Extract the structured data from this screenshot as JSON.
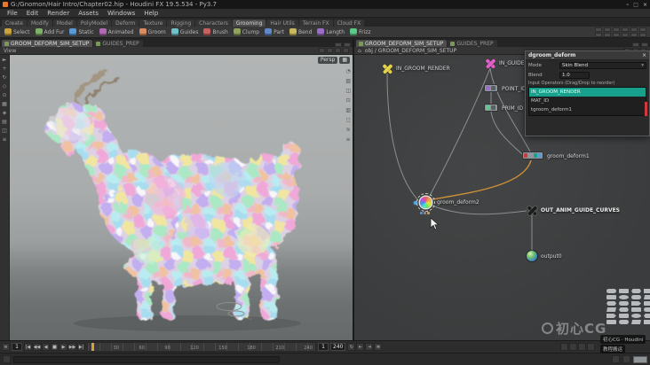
{
  "titlebar": {
    "title": "G:/Gnomon/Hair Intro/Chapter02.hip - Houdini FX 19.5.534 - Py3.7",
    "window_buttons": [
      "–",
      "□",
      "×"
    ]
  },
  "menubar": {
    "items": [
      "File",
      "Edit",
      "Render",
      "Assets",
      "Windows",
      "Help"
    ]
  },
  "shelf": {
    "tabs": [
      "Create",
      "Modify",
      "Model",
      "PolyModel",
      "Deform",
      "Texture",
      "Rigging",
      "Characters",
      "Grooming",
      "Hair Utils",
      "Terrain FX",
      "Cloud FX"
    ],
    "tools": [
      {
        "label": "Select",
        "color": "#c9a33b"
      },
      {
        "label": "Add Fur",
        "color": "#7fb069"
      },
      {
        "label": "Static",
        "color": "#5b9bd5"
      },
      {
        "label": "Animated",
        "color": "#b06ab3"
      },
      {
        "label": "Groom",
        "color": "#d98c5f"
      },
      {
        "label": "Guides",
        "color": "#6fc2c9"
      },
      {
        "label": "Brush",
        "color": "#c95f5f"
      },
      {
        "label": "Clump",
        "color": "#8fa35b"
      },
      {
        "label": "Part",
        "color": "#5f89c9"
      },
      {
        "label": "Bend",
        "color": "#c9b85f"
      },
      {
        "label": "Length",
        "color": "#9b6fc9"
      },
      {
        "label": "Frizz",
        "color": "#5fc98a"
      }
    ]
  },
  "pane_tabs": {
    "left": [
      "GROOM_DEFORM_SIM_SETUP",
      "GUIDES_PREP"
    ],
    "right": [
      "GROOM_DEFORM_SIM_SETUP",
      "GUIDES_PREP"
    ]
  },
  "viewport": {
    "menu": "View",
    "camera": "Persp",
    "cam_icon": "▦",
    "left_toolbar": [
      "►",
      "+",
      "↻",
      "◇",
      "⊙",
      "▦",
      "◈",
      "▤",
      "◫",
      "≡"
    ],
    "right_toolbar": [
      "◔",
      "▧",
      "◫",
      "⊡",
      "▥",
      "◻",
      "≋",
      "≡"
    ]
  },
  "network": {
    "breadcrumb_home": "⌂",
    "breadcrumb": "obj / GROOM_DEFORM_SIM_SETUP",
    "labels": {
      "in_groom_render": "IN_GROOM_RENDER",
      "in_guide_curves": "IN_GUIDE_CURVES",
      "point_id": "POINT_ID",
      "prim_id": "PRIM_ID",
      "groom_deform1": "groom_deform1",
      "groom_deform2": "groom_deform2",
      "out_anim": "OUT_ANIM_GUIDE_CURVES",
      "output0": "output0"
    }
  },
  "param_panel": {
    "title": "dgroom_deform",
    "close": "×",
    "rows": [
      {
        "label": "Mode",
        "value": "Skin Blend"
      },
      {
        "label": "Blend",
        "value": "1.0"
      }
    ],
    "list_label": "Input Operators (Drag/Drop to reorder)",
    "items": [
      "IN_GROOM_RENDER",
      "MAT_ID",
      "tgroom_deform1"
    ]
  },
  "playbar": {
    "current": "1",
    "transport": [
      "|◀",
      "◀◀",
      "◀",
      "■",
      "▶",
      "▶▶",
      "▶|"
    ],
    "ticks": [
      "1",
      "30",
      "60",
      "90",
      "120",
      "150",
      "180",
      "210",
      "240"
    ],
    "start": "1",
    "end": "240",
    "options": [
      "↻",
      "⇤",
      "⇥",
      "≣"
    ]
  },
  "watermark": {
    "main": "初心CG",
    "badge1": "初心CG · Houdini",
    "badge2": "教程搬运"
  }
}
